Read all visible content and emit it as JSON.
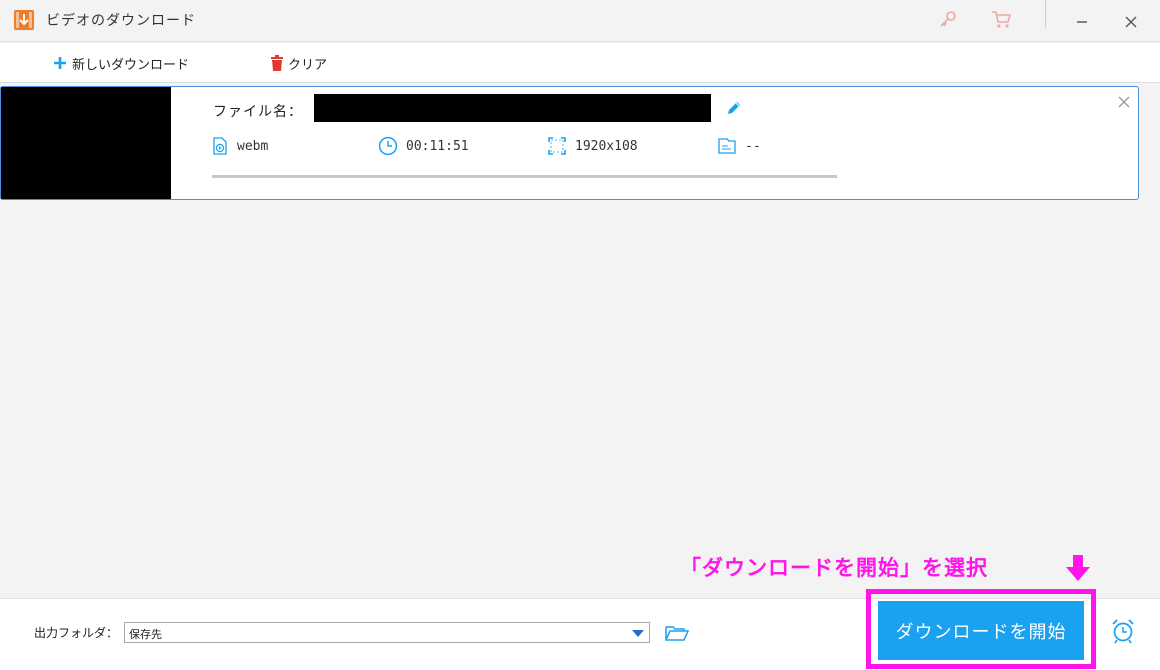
{
  "window": {
    "title": "ビデオのダウンロード",
    "icons": {
      "app": "download-app-icon",
      "key": "key-icon",
      "cart": "cart-icon",
      "minimize": "minimize-icon",
      "close": "close-icon"
    }
  },
  "toolbar": {
    "new_download_label": "新しいダウンロード",
    "clear_label": "クリア"
  },
  "task": {
    "filename_label": "ファイル名：",
    "format": "webm",
    "duration": "00:11:51",
    "resolution": "1920x108",
    "size": "--",
    "progress": 0
  },
  "output": {
    "label": "出力フォルダ：",
    "folder_value": "保存先"
  },
  "start_button_label": "ダウンロードを開始",
  "annotation_text": "「ダウンロードを開始」を選択",
  "colors": {
    "accent": "#1aa1f0",
    "highlight": "#ff14ea",
    "card_border": "#4a90d9",
    "clear_icon": "#e03a2f",
    "app_icon": "#f07d2a"
  }
}
